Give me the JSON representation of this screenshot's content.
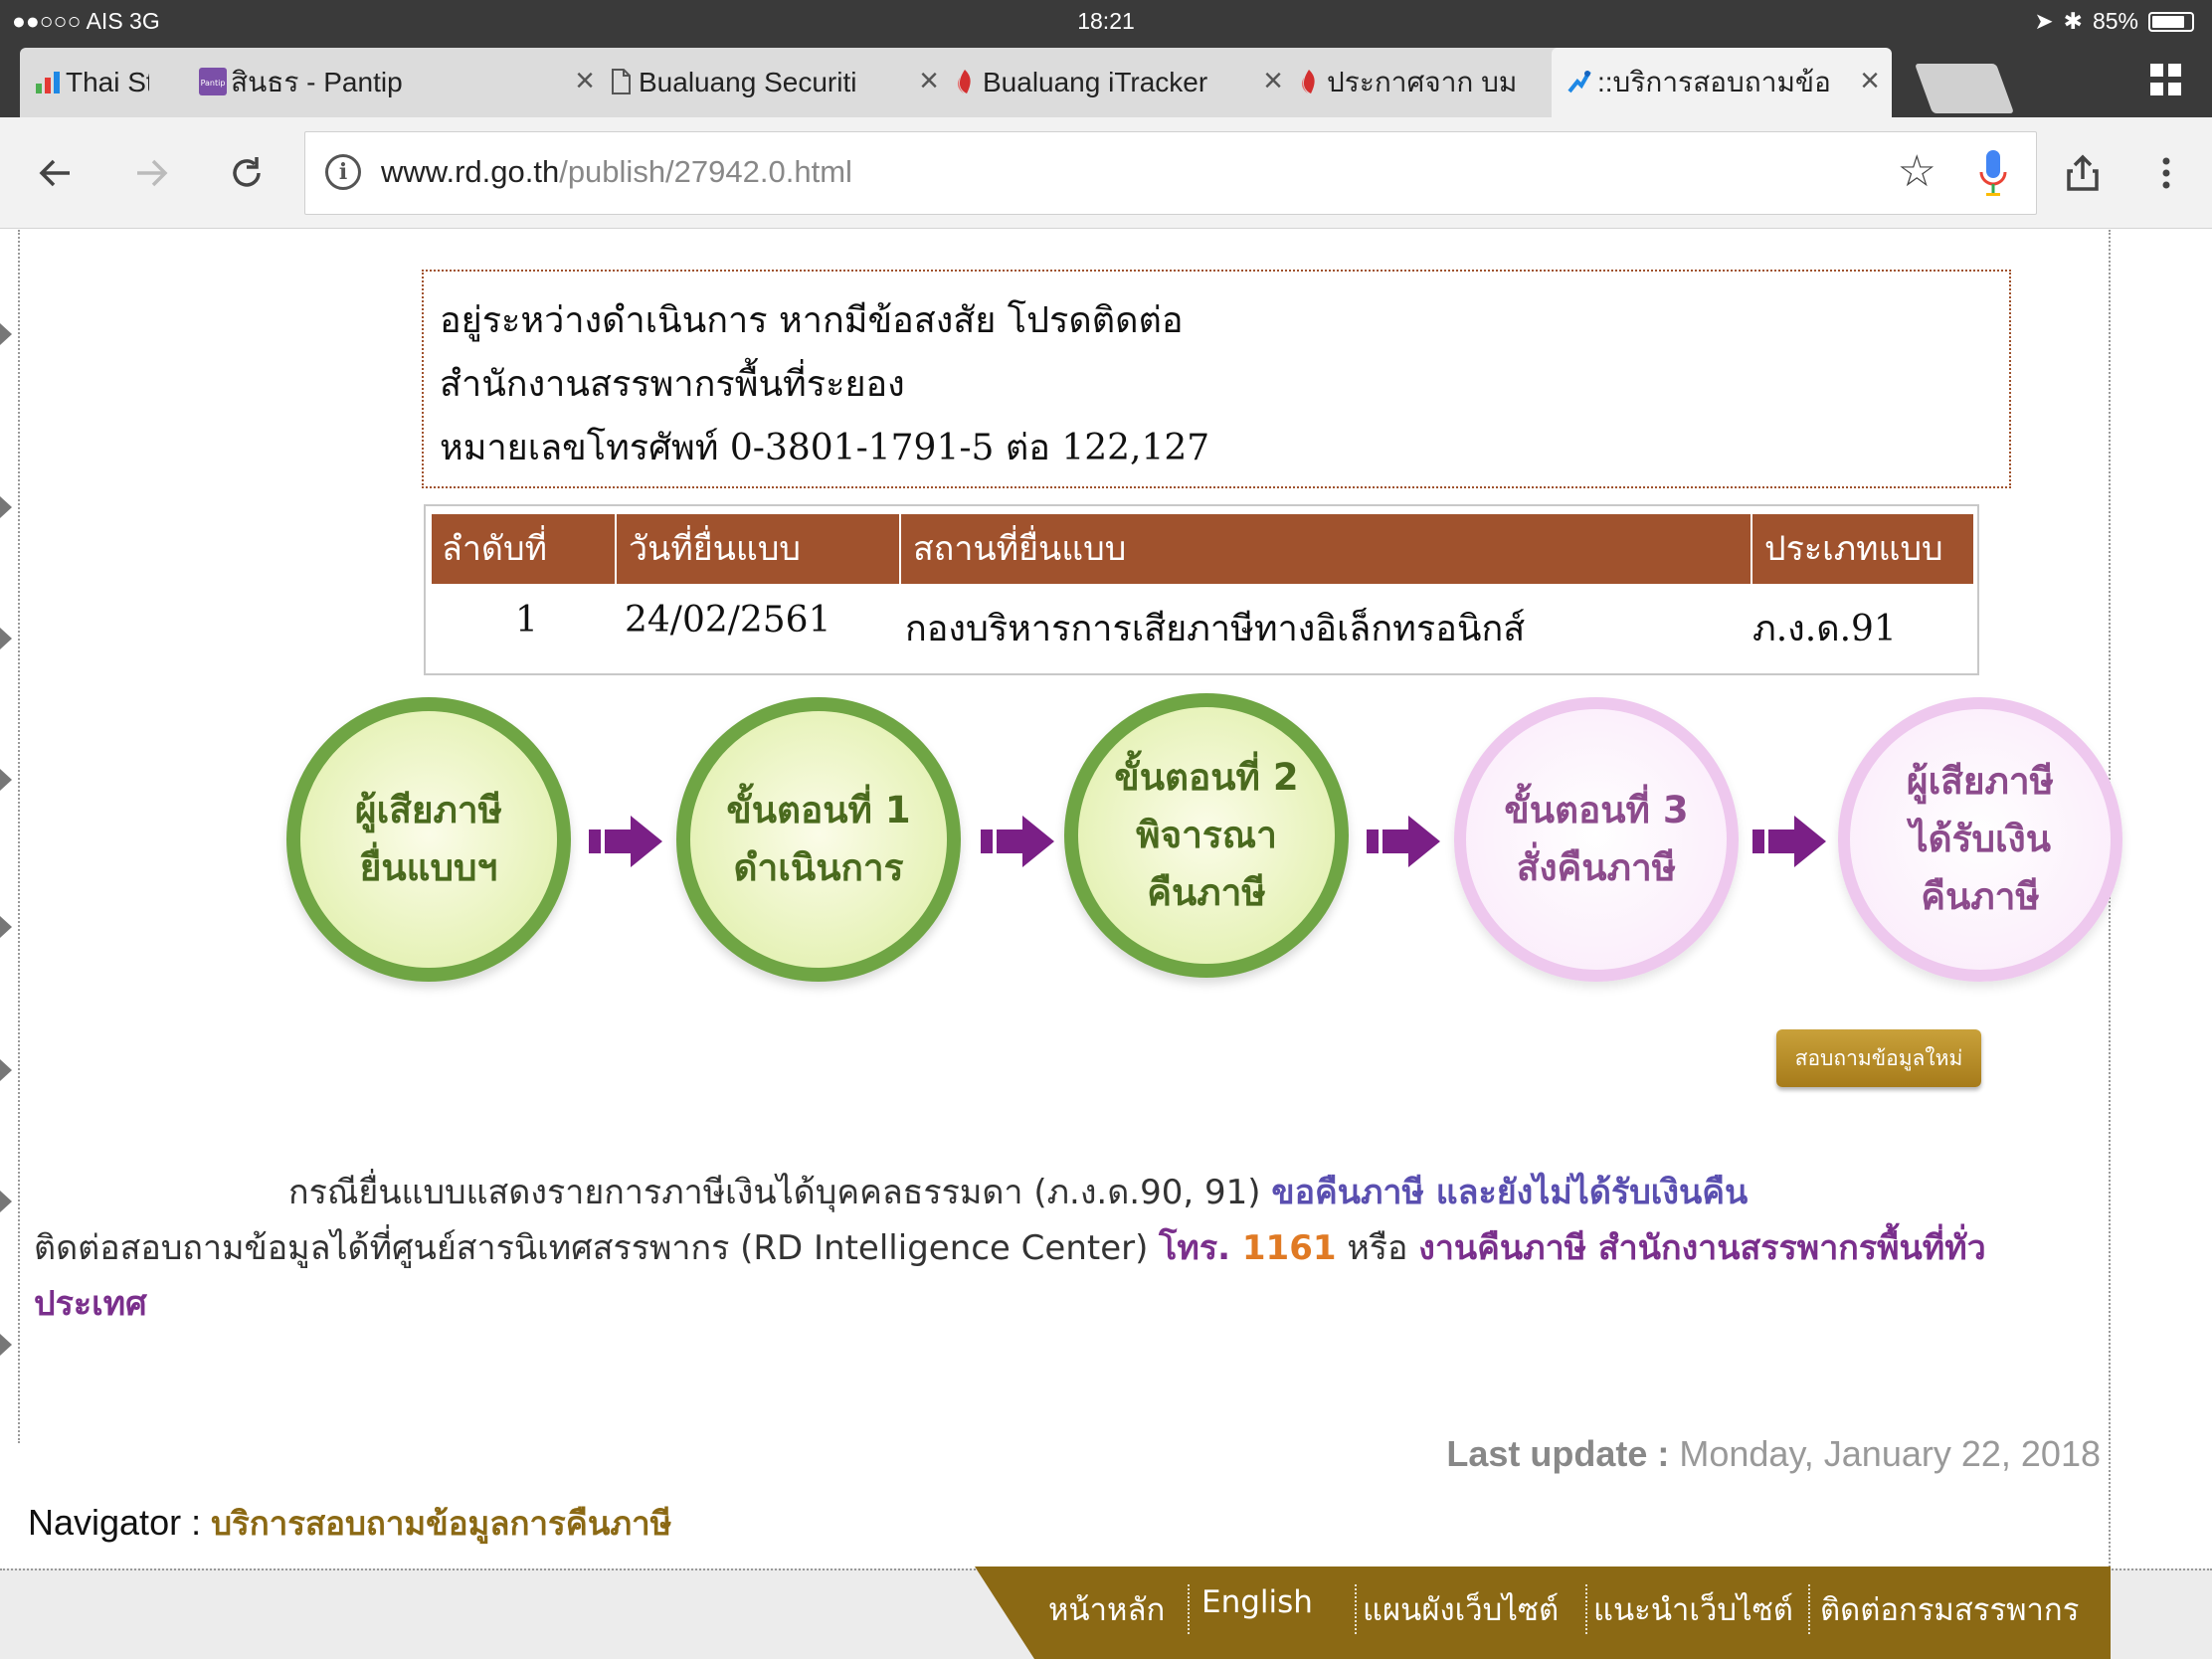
{
  "status_bar": {
    "carrier": "●●○○○ AIS  3G",
    "time": "18:21",
    "battery": "85%",
    "battery_level": 0.85
  },
  "tabs": [
    {
      "title": "Thai Stock",
      "icon": "bar-chart-icon",
      "close": ""
    },
    {
      "title": "สินธร - Pantip",
      "icon": "pantip-icon",
      "close": "×"
    },
    {
      "title": "Bualuang Securiti",
      "icon": "document-icon",
      "close": "×"
    },
    {
      "title": "Bualuang iTracker",
      "icon": "bualuang-flame-icon",
      "close": "×"
    },
    {
      "title": "ประกาศจาก บม",
      "icon": "bualuang-flame-icon",
      "close": ""
    },
    {
      "title": "::บริการสอบถามข้อ",
      "icon": "rd-logo-icon",
      "close": "×"
    }
  ],
  "address": {
    "host": "www.rd.go.th",
    "path": "/publish/27942.0.html"
  },
  "notice": {
    "line1": "อยู่ระหว่างดำเนินการ หากมีข้อสงสัย โปรดติดต่อ",
    "line2": "สำนักงานสรรพากรพื้นที่ระยอง",
    "line3": "หมายเลขโทรศัพท์ 0-3801-1791-5 ต่อ 122,127"
  },
  "filing_table": {
    "headers": [
      "ลำดับที่",
      "วันที่ยื่นแบบ",
      "สถานที่ยื่นแบบ",
      "ประเภทแบบ"
    ],
    "rows": [
      [
        "1",
        "24/02/2561",
        "กองบริหารการเสียภาษีทางอิเล็กทรอนิกส์",
        "ภ.ง.ด.91"
      ]
    ]
  },
  "process_steps": [
    {
      "line1": "ผู้เสียภาษี",
      "line2": "ยื่นแบบฯ",
      "line3": "",
      "state": "done"
    },
    {
      "line1": "ขั้นตอนที่ 1",
      "line2": "ดำเนินการ",
      "line3": "",
      "state": "done"
    },
    {
      "line1": "ขั้นตอนที่ 2",
      "line2": "พิจารณา",
      "line3": "คืนภาษี",
      "state": "done"
    },
    {
      "line1": "ขั้นตอนที่ 3",
      "line2": "สั่งคืนภาษี",
      "line3": "",
      "state": "pending"
    },
    {
      "line1": "ผู้เสียภาษี",
      "line2": "ได้รับเงิน",
      "line3": "คืนภาษี",
      "state": "pending"
    }
  ],
  "inquire_button_label": "สอบถามข้อมูลใหม่",
  "info": {
    "part1": "กรณียื่นแบบแสดงรายการภาษีเงินได้บุคคลธรรมดา (ภ.ง.ด.90, 91) ",
    "part2": "ขอคืนภาษี และยังไม่ได้รับเงินคืน",
    "part3": "ติดต่อสอบถามข้อมูลได้ที่ศูนย์สารนิเทศสรรพากร (RD Intelligence Center) ",
    "part4": "โทร. ",
    "part5": "1161",
    "part6": " หรือ ",
    "part7": "งานคืนภาษี สำนักงานสรรพากรพื้นที่ทั่วประเทศ"
  },
  "last_update": {
    "label": "Last update :",
    "date": "Monday, January 22, 2018"
  },
  "navigator": {
    "label": "Navigator :",
    "link": "บริการสอบถามข้อมูลการคืนภาษี"
  },
  "footer_links": [
    "หน้าหลัก",
    "English",
    "แผนผังเว็บไซต์",
    "แนะนำเว็บไซต์",
    "ติดต่อกรมสรรพากร"
  ],
  "colors": {
    "table_header": "#a0522d",
    "step_green_border": "#6fa544",
    "step_pink_border": "#eec8ee",
    "arrow": "#7a1f86",
    "footer": "#8b6914"
  }
}
